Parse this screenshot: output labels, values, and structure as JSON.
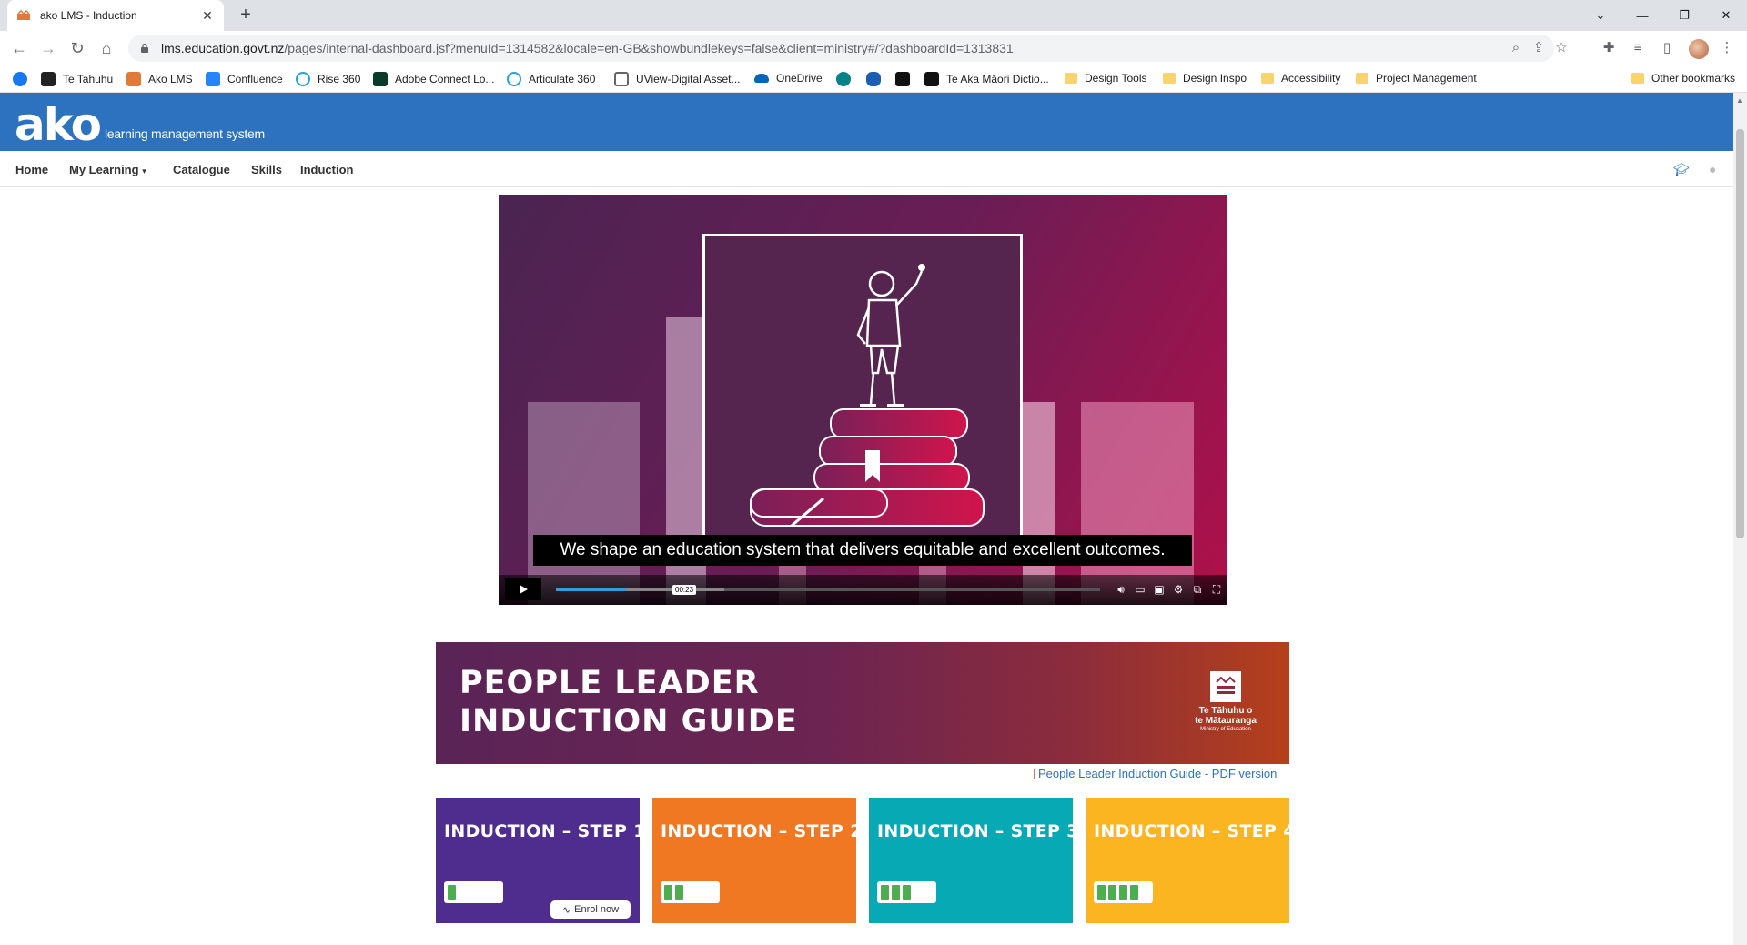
{
  "browser": {
    "tab": {
      "title": "ako LMS - Induction"
    },
    "url": {
      "host": "lms.education.govt.nz",
      "path": "/pages/internal-dashboard.jsf?menuId=1314582&locale=en-GB&showbundlekeys=false&client=ministry#/?dashboardId=1313831"
    },
    "bookmarks": [
      {
        "label": "Te Tahuhu"
      },
      {
        "label": "Ako LMS"
      },
      {
        "label": "Confluence"
      },
      {
        "label": "Rise 360"
      },
      {
        "label": "Adobe Connect Lo..."
      },
      {
        "label": "Articulate 360"
      },
      {
        "label": "UView-Digital Asset..."
      },
      {
        "label": "OneDrive"
      },
      {
        "label": "Te Aka Māori Dictio..."
      },
      {
        "label": "Design Tools"
      },
      {
        "label": "Design Inspo"
      },
      {
        "label": "Accessibility"
      },
      {
        "label": "Project Management"
      },
      {
        "label": "Other bookmarks"
      }
    ]
  },
  "header": {
    "logo": "ako",
    "subtitle": "learning management system",
    "color": "#2d72bf"
  },
  "nav": {
    "home": "Home",
    "my_learning": "My Learning",
    "catalogue": "Catalogue",
    "skills": "Skills",
    "induction": "Induction"
  },
  "video": {
    "caption": "We shape an education system that delivers equitable and excellent outcomes.",
    "time_tooltip": "00:23",
    "progress_fraction": 0.13,
    "buffered_fraction": 0.31
  },
  "guide": {
    "title_line1": "PEOPLE LEADER",
    "title_line2": "INDUCTION GUIDE",
    "logo_name_line1": "Te Tāhuhu o",
    "logo_name_line2": "te Mātauranga",
    "logo_sub": "Ministry of Education",
    "pdf_link": "People Leader Induction Guide - PDF version"
  },
  "steps": [
    {
      "title": "INDUCTION – STEP 1",
      "color": "#4f2d8e",
      "filled_cells": 1,
      "button": "Enrol now"
    },
    {
      "title": "INDUCTION – STEP 2",
      "color": "#f07822",
      "filled_cells": 2
    },
    {
      "title": "INDUCTION – STEP 3",
      "color": "#07a9b4",
      "filled_cells": 3
    },
    {
      "title": "INDUCTION – STEP 4",
      "color": "#fbb521",
      "filled_cells": 4
    }
  ]
}
